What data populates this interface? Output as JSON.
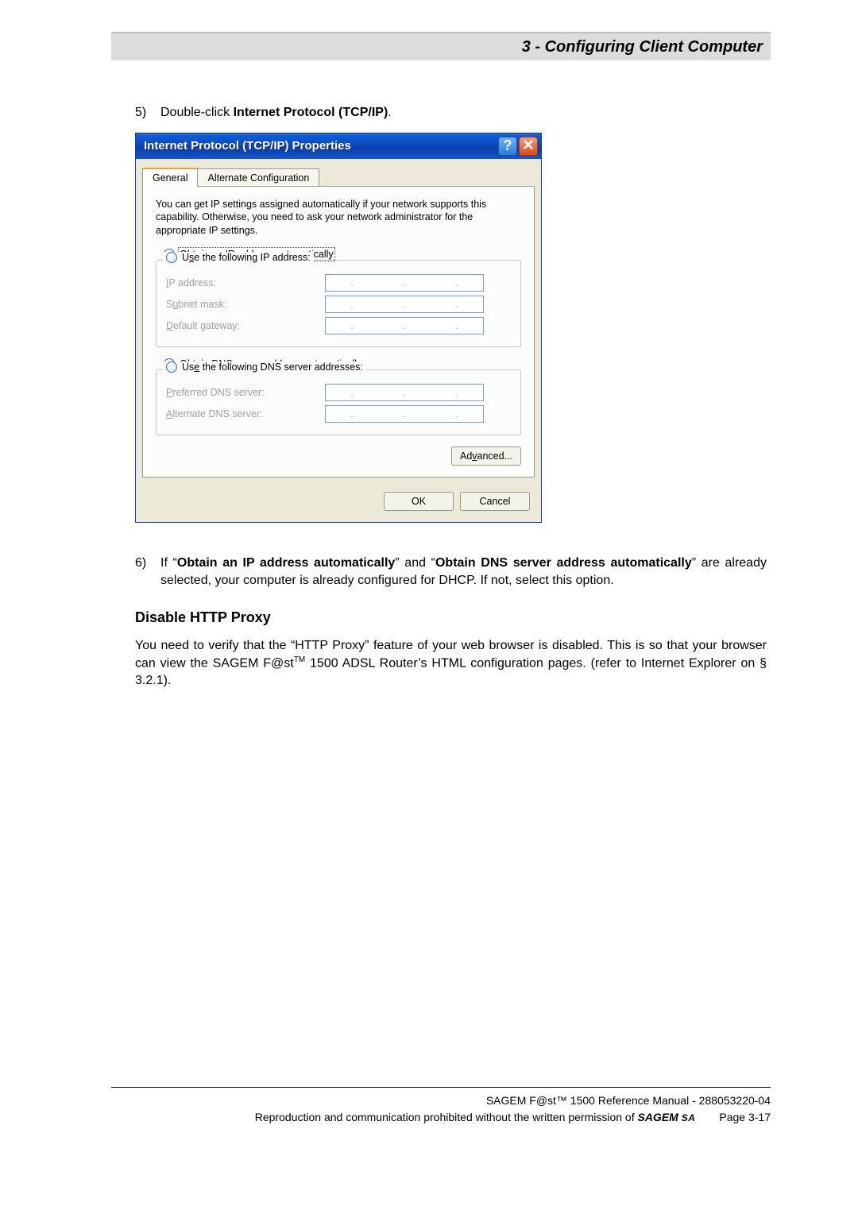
{
  "header": "3 - Configuring Client Computer",
  "step5": {
    "num": "5)",
    "prefix": "Double-click ",
    "bold": "Internet Protocol (TCP/IP)",
    "suffix": "."
  },
  "dialog": {
    "title": "Internet Protocol (TCP/IP) Properties",
    "help": "?",
    "close": "✕",
    "tabs": {
      "general": "General",
      "alt": "Alternate Configuration"
    },
    "intro": "You can get IP settings assigned automatically if your network supports this capability. Otherwise, you need to ask your network administrator for the appropriate IP settings.",
    "opt_auto_ip_pre": "O",
    "opt_auto_ip": "btain an IP address automatically",
    "opt_use_ip_pre": "U",
    "opt_use_ip_mid": "s",
    "opt_use_ip_rest": "e the following IP address:",
    "lbl_ip_pre": "I",
    "lbl_ip_rest": "P address:",
    "lbl_sub_pre": "S",
    "lbl_sub_mid": "u",
    "lbl_sub_rest": "bnet mask:",
    "lbl_gw_pre": "D",
    "lbl_gw_rest": "efault gateway:",
    "opt_auto_dns_pre": "O",
    "opt_auto_dns_mid": "b",
    "opt_auto_dns_rest": "tain DNS server address automatically",
    "opt_use_dns_pre": "Us",
    "opt_use_dns_mid": "e",
    "opt_use_dns_rest": " the following DNS server addresses:",
    "lbl_pdns_pre": "P",
    "lbl_pdns_rest": "referred DNS server:",
    "lbl_adns_pre": "A",
    "lbl_adns_rest": "lternate DNS server:",
    "dot": ".",
    "advanced_pre": "Ad",
    "advanced_mid": "v",
    "advanced_rest": "anced...",
    "ok": "OK",
    "cancel": "Cancel"
  },
  "step6": {
    "num": "6)",
    "p1": "If “",
    "b1": "Obtain an IP address automatically",
    "p2": "” and “",
    "b2": "Obtain DNS server address automatically",
    "p3": "” are already selected, your computer is already configured for DHCP. If not, select this option."
  },
  "section_heading": "Disable HTTP Proxy",
  "para_proxy_1": "You need to verify that the “HTTP Proxy” feature of your web browser is disabled. This is so that your browser can view the SAGEM F@st",
  "para_proxy_tm": "TM",
  "para_proxy_2": " 1500 ADSL Router’s HTML configuration pages. (refer to Internet Explorer on § 3.2.1).",
  "footer": {
    "line1": "SAGEM F@st™ 1500 Reference Manual - 288053220-04",
    "line2_pre": "Reproduction and communication prohibited without the written permission of ",
    "brand": "SAGEM ",
    "brand_sa": "SA",
    "page": "Page 3-17"
  }
}
